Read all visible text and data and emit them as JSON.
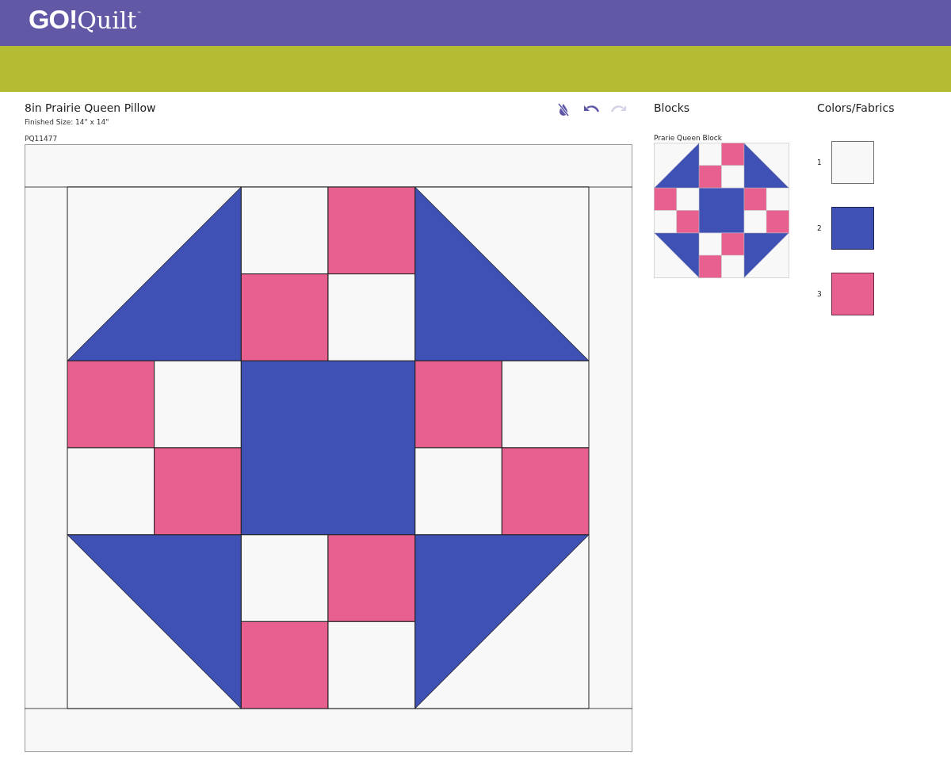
{
  "header": {
    "logo": {
      "mark": "GO!",
      "name": "Quilt",
      "tm": "™"
    }
  },
  "project": {
    "title": "8in Prairie Queen Pillow",
    "finished_size": "Finished Size: 14\" x 14\"",
    "code": "PQ11477"
  },
  "toolbar": [
    {
      "kind": "fill-off",
      "disabled": false
    },
    {
      "kind": "undo",
      "disabled": false
    },
    {
      "kind": "redo",
      "disabled": true
    }
  ],
  "blocks": {
    "heading": "Blocks",
    "items": [
      {
        "label": "Prarie Queen Block"
      }
    ]
  },
  "fabrics": {
    "heading": "Colors/Fabrics",
    "items": [
      {
        "number": "1",
        "color": "#f8f8f8"
      },
      {
        "number": "2",
        "color": "#3f51b5"
      },
      {
        "number": "3",
        "color": "#e86090"
      }
    ]
  }
}
